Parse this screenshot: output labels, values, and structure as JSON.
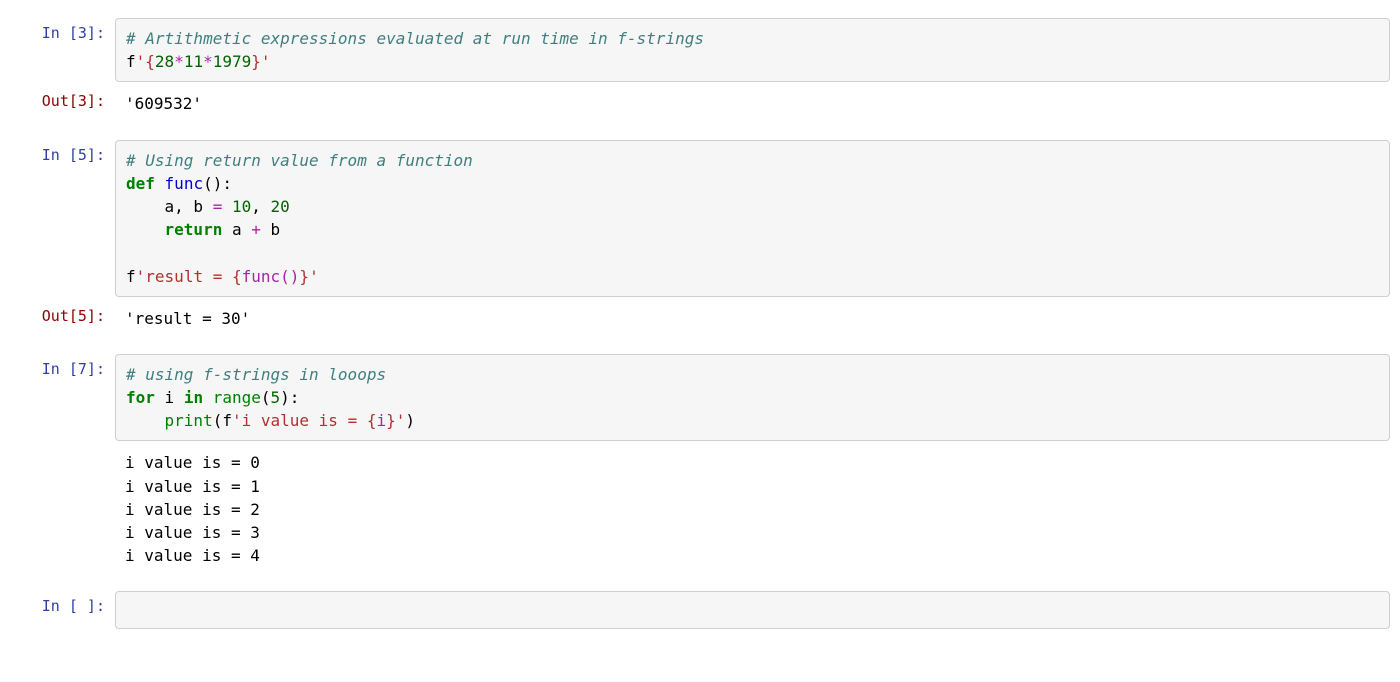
{
  "cells": {
    "cell1": {
      "prompt_in": "In [3]:",
      "code": {
        "t0": "# Artithmetic expressions evaluated at run time in f-strings",
        "t1": "f",
        "t2": "'",
        "t3": "{",
        "t4": "28",
        "t5": "*",
        "t6": "11",
        "t7": "*",
        "t8": "1979",
        "t9": "}",
        "t10": "'"
      },
      "prompt_out": "Out[3]:",
      "output": "'609532'"
    },
    "cell2": {
      "prompt_in": "In [5]:",
      "code": {
        "l0": "# Using return value from a function",
        "l1a": "def",
        "l1b": " ",
        "l1c": "func",
        "l1d": "():",
        "l2a": "    a, b ",
        "l2b": "=",
        "l2c": " ",
        "l2d": "10",
        "l2e": ", ",
        "l2f": "20",
        "l3a": "    ",
        "l3b": "return",
        "l3c": " a ",
        "l3d": "+",
        "l3e": " b",
        "l5a": "f",
        "l5b": "'",
        "l5c": "result = ",
        "l5d": "{",
        "l5e": "func()",
        "l5f": "}",
        "l5g": "'"
      },
      "prompt_out": "Out[5]:",
      "output": "'result = 30'"
    },
    "cell3": {
      "prompt_in": "In [7]:",
      "code": {
        "l0": "# using f-strings in looops",
        "l1a": "for",
        "l1b": " i ",
        "l1c": "in",
        "l1d": " ",
        "l1e": "range",
        "l1f": "(",
        "l1g": "5",
        "l1h": "):",
        "l2a": "    ",
        "l2b": "print",
        "l2c": "(f",
        "l2d": "'",
        "l2e": "i value is = ",
        "l2f": "{",
        "l2g": "i",
        "l2h": "}",
        "l2i": "'",
        "l2j": ")"
      },
      "stream": "i value is = 0\ni value is = 1\ni value is = 2\ni value is = 3\ni value is = 4"
    },
    "cell4": {
      "prompt_in": "In [ ]:"
    }
  }
}
